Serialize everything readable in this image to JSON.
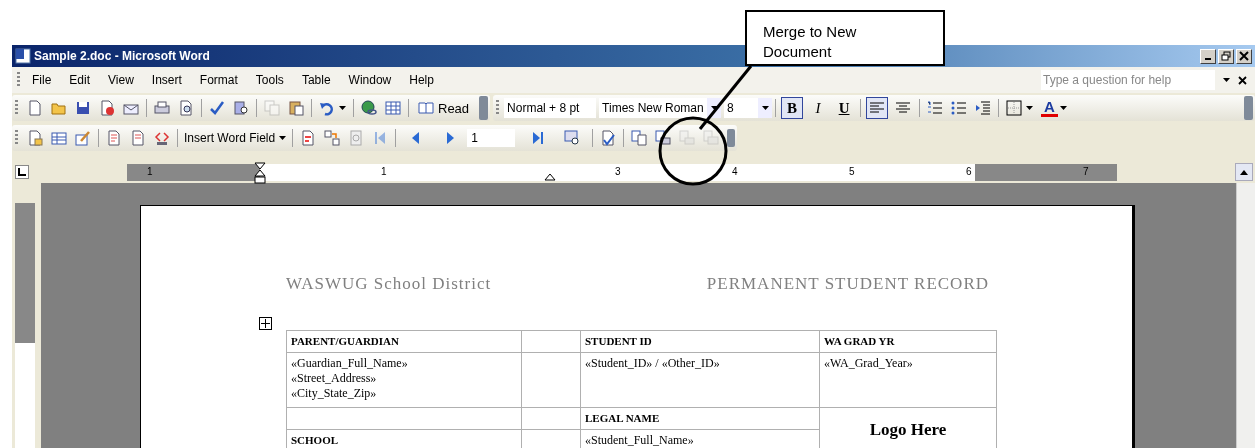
{
  "callout": {
    "text": "Merge to New Document"
  },
  "window": {
    "title": "Sample 2.doc - Microsoft Word"
  },
  "menu": {
    "items": [
      "File",
      "Edit",
      "View",
      "Insert",
      "Format",
      "Tools",
      "Table",
      "Window",
      "Help"
    ],
    "help_box": {
      "placeholder": "Type a question for help"
    }
  },
  "standard_toolbar": {
    "buttons": [
      {
        "disabled": false
      },
      {
        "disabled": false
      },
      {
        "disabled": false
      },
      {
        "disabled": false
      },
      {
        "disabled": false
      },
      {
        "disabled": false
      },
      {
        "disabled": false
      },
      {
        "disabled": false
      },
      {
        "disabled": false
      },
      {
        "disabled": true
      },
      {
        "disabled": false
      },
      {
        "disabled": false
      },
      {
        "disabled": false
      },
      {
        "disabled": false
      }
    ],
    "read_button": "Read"
  },
  "formatting_toolbar": {
    "style": "Normal + 8 pt",
    "font": "Times New Roman",
    "size": "8",
    "toggles": [
      {
        "label": "B",
        "selected": true
      },
      {
        "label": "I",
        "selected": false
      },
      {
        "label": "U",
        "selected": false
      }
    ],
    "alignment": [
      {
        "selected": true
      },
      {
        "selected": false
      }
    ],
    "font_color_label": "A"
  },
  "mail_merge_toolbar": {
    "insert_field": "Insert Word Field",
    "record": "1",
    "buttons": [
      {
        "disabled": false
      },
      {
        "disabled": false
      },
      {
        "disabled": false
      },
      {
        "disabled": false
      },
      {
        "disabled": false
      },
      {
        "disabled": false
      },
      {
        "disabled": false
      },
      {
        "disabled": false
      },
      {
        "disabled": false
      },
      {
        "disabled": true
      },
      {
        "disabled": false
      },
      {
        "disabled": false
      },
      {
        "disabled": false
      },
      {
        "disabled": false
      },
      {
        "disabled": false
      },
      {
        "disabled": false
      },
      {
        "disabled": false
      },
      {
        "disabled": true
      },
      {
        "disabled": true
      }
    ]
  },
  "ruler": {
    "labels": [
      "1",
      "1",
      "3",
      "4",
      "5",
      "6",
      "7"
    ]
  },
  "document": {
    "header_left": "WASWUG School District",
    "header_right": "PERMANENT STUDENT RECORD",
    "table": {
      "rows": [
        {
          "cells": [
            {
              "lines": [
                "PARENT/GUARDIAN"
              ],
              "bold": true
            },
            {},
            {
              "lines": [
                "STUDENT ID"
              ],
              "bold": true
            },
            {
              "lines": [
                "WA GRAD YR"
              ],
              "bold": true
            }
          ]
        },
        {
          "cells": [
            {
              "lines": [
                "«Guardian_Full_Name»",
                "«Street_Address»",
                "«City_State_Zip»"
              ],
              "bold": false
            },
            {},
            {
              "lines": [
                "«Student_ID» / «Other_ID»"
              ],
              "bold": false
            },
            {
              "lines": [
                "«WA_Grad_Year»"
              ],
              "bold": false
            }
          ]
        },
        {
          "cells": [
            {},
            {},
            {
              "lines": [
                "LEGAL NAME"
              ],
              "bold": true
            }
          ]
        },
        {
          "cells": [
            {
              "lines": [
                "SCHOOL"
              ],
              "bold": true
            },
            {},
            {
              "lines": [
                "«Student_Full_Name»"
              ],
              "bold": false
            }
          ]
        }
      ],
      "logo": "Logo Here"
    }
  }
}
